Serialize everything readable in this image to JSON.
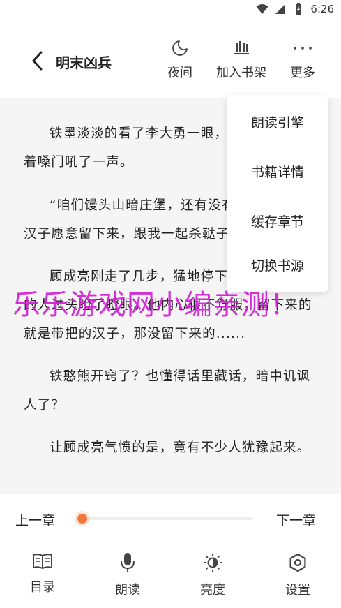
{
  "status_bar": {
    "time": "6:26",
    "icons": [
      "wifi-icon",
      "signal-icon",
      "battery-icon"
    ]
  },
  "header": {
    "book_title": "明末凶兵",
    "actions": [
      {
        "label": "夜间",
        "icon": "moon-icon"
      },
      {
        "label": "加入书架",
        "icon": "bookshelf-icon"
      },
      {
        "label": "更多",
        "icon": "more-dots-icon"
      }
    ]
  },
  "content": {
    "paragraphs": [
      "铁墨淡淡的看了李大勇一眼，李大勇立刻扯着嗓门吼了一声。",
      "“咱们馒头山暗庄堡，还有没有带把的汉子，汉子愿意留下来，跟我一起杀鞑子。”",
      "顾成亮刚走了几步，猛地停下，他看着身边的人过头瞪了瞪眼。他内心很不舒服，留下来的就是带把的汉子，那没留下来的......",
      "铁憨熊开窍了？也懂得话里藏话，暗中讥讽人了？",
      "让顾成亮气愤的是，竟有不少人犹豫起来。"
    ]
  },
  "menu": {
    "items": [
      "朗读引擎",
      "书籍详情",
      "缓存章节",
      "切换书源"
    ]
  },
  "watermark": "乐乐游戏网小编亲测！",
  "bottom": {
    "prev_label": "上一章",
    "next_label": "下一章",
    "progress": 0.0,
    "tabs": [
      {
        "label": "目录",
        "icon": "catalog-icon"
      },
      {
        "label": "朗读",
        "icon": "microphone-icon"
      },
      {
        "label": "亮度",
        "icon": "brightness-icon"
      },
      {
        "label": "设置",
        "icon": "settings-icon"
      }
    ]
  },
  "colors": {
    "accent": "#f2773a",
    "watermark": "#d21ed6",
    "page_bg": "#f5f5f5"
  }
}
